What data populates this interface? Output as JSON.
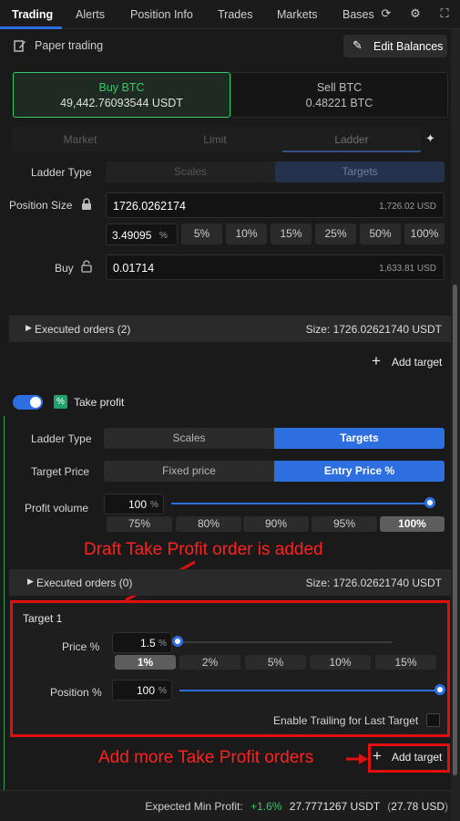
{
  "tabs": [
    "Trading",
    "Alerts",
    "Position Info",
    "Trades",
    "Markets",
    "Bases"
  ],
  "header_icons": [
    "refresh-icon",
    "gear-icon",
    "expand-icon"
  ],
  "paper_trading": {
    "label": "Paper trading",
    "edit_balances": "Edit Balances"
  },
  "buy_btn": {
    "title": "Buy BTC",
    "value": "49,442.76093544 USDT"
  },
  "sell_btn": {
    "title": "Sell BTC",
    "value": "0.48221 BTC"
  },
  "order_tabs": [
    "Market",
    "Limit",
    "Ladder"
  ],
  "ladder": {
    "label": "Ladder Type",
    "options": [
      "Scales",
      "Targets"
    ],
    "selected": "Targets"
  },
  "position_size": {
    "label": "Position Size",
    "value": "1726.0262174",
    "usd": "1,726.02 USD"
  },
  "percent": {
    "value": "3.49095",
    "unit": "%",
    "chips": [
      "5%",
      "10%",
      "15%",
      "25%",
      "50%",
      "100%"
    ]
  },
  "buy": {
    "label": "Buy",
    "value": "0.01714",
    "usd": "1,633.81 USD"
  },
  "executed_top": {
    "label": "Executed orders (2)",
    "size": "Size: 1726.02621740 USDT"
  },
  "add_target_top": "Add target",
  "take_profit": {
    "label": "Take profit",
    "ladder_label": "Ladder Type",
    "ladder_options": [
      "Scales",
      "Targets"
    ],
    "target_price_label": "Target Price",
    "target_price_options": [
      "Fixed price",
      "Entry Price %"
    ],
    "profit_volume_label": "Profit volume",
    "profit_volume_value": "100",
    "profit_volume_unit": "%",
    "profit_volume_fraction": 1.0,
    "profit_chips": [
      "75%",
      "80%",
      "90%",
      "95%",
      "100%"
    ]
  },
  "annotation_draft": "Draft Take Profit order is added",
  "executed_bottom": {
    "label": "Executed orders (0)",
    "size": "Size: 1726.02621740 USDT"
  },
  "target1": {
    "title": "Target 1",
    "price_label": "Price %",
    "price_value": "1.5",
    "price_unit": "%",
    "price_fraction": 0.0,
    "price_chips": [
      "1%",
      "2%",
      "5%",
      "10%",
      "15%"
    ],
    "position_label": "Position %",
    "position_value": "100",
    "position_unit": "%",
    "position_fraction": 1.0,
    "trailing_label": "Enable Trailing for Last Target"
  },
  "annotation_more": "Add more Take Profit orders",
  "add_target_bottom": "Add target",
  "footer": {
    "label": "Expected Min Profit:",
    "pct": "+1.6%",
    "usdt": "27.7771267 USDT",
    "usd_open": "(",
    "usd": "27.78 USD",
    "usd_close": ")"
  },
  "colors": {
    "accent": "#2d6fe0",
    "buy_green": "#35c96a",
    "annotation_red": "#e01010"
  }
}
